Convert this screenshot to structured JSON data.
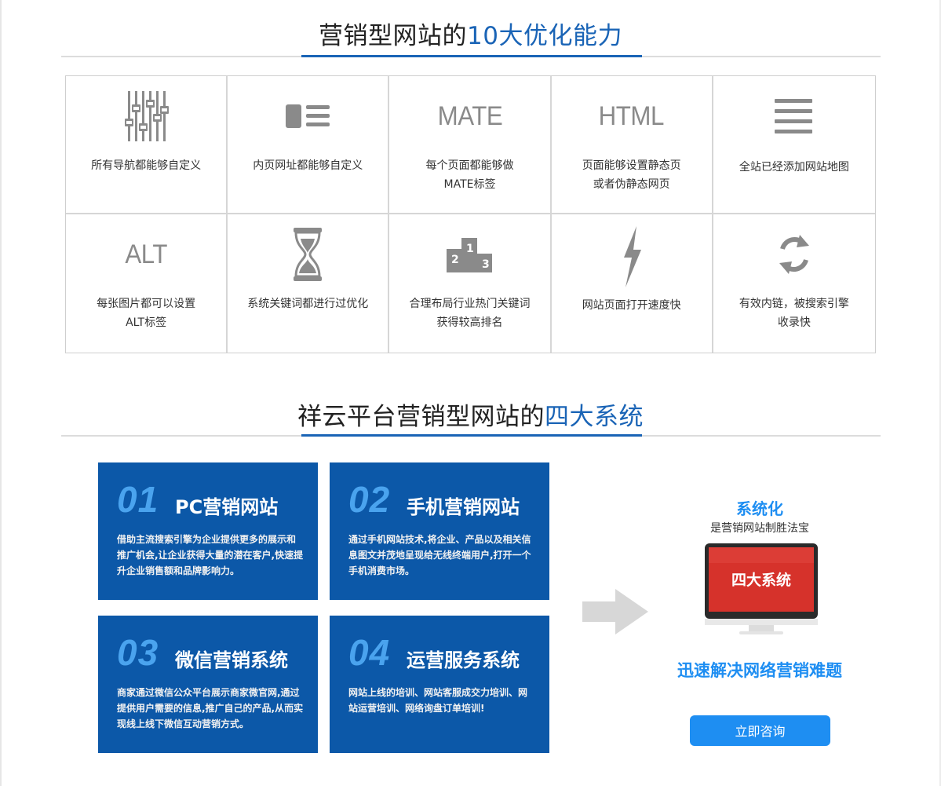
{
  "section1": {
    "title_main": "营销型网站的",
    "title_highlight": "10大优化能力"
  },
  "features": [
    {
      "icon": "sliders-icon",
      "caption": "所有导航都能够自定义"
    },
    {
      "icon": "list-layout-icon",
      "caption": "内页网址都能够自定义"
    },
    {
      "icon": "mate-text-icon",
      "icon_text": "MATE",
      "caption": "每个页面都能够做\nMATE标签"
    },
    {
      "icon": "html-text-icon",
      "icon_text": "HTML",
      "caption": "页面能够设置静态页\n或者伪静态网页"
    },
    {
      "icon": "menu-lines-icon",
      "caption": "全站已经添加网站地图"
    },
    {
      "icon": "alt-text-icon",
      "icon_text": "ALT",
      "caption": "每张图片都可以设置\nALT标签"
    },
    {
      "icon": "hourglass-icon",
      "caption": "系统关键词都进行过优化"
    },
    {
      "icon": "podium-icon",
      "caption": "合理布局行业热门关键词\n获得较高排名"
    },
    {
      "icon": "lightning-icon",
      "caption": "网站页面打开速度快"
    },
    {
      "icon": "refresh-icon",
      "caption": "有效内链，被搜索引擎\n收录快"
    }
  ],
  "section2": {
    "title_main": "祥云平台营销型网站的",
    "title_highlight": "四大系统"
  },
  "systems": [
    {
      "num": "01",
      "name": "PC营销网站",
      "desc": "借助主流搜索引擎为企业提供更多的展示和推广机会,让企业获得大量的潜在客户,快速提升企业销售额和品牌影响力。"
    },
    {
      "num": "02",
      "name": "手机营销网站",
      "desc": "通过手机网站技术,将企业、产品以及相关信息图文并茂地呈现给无线终端用户,打开一个手机消费市场。"
    },
    {
      "num": "03",
      "name": "微信营销系统",
      "desc": "商家通过微信公众平台展示商家微官网,通过提供用户需要的信息,推广自己的产品,从而实现线上线下微信互动营销方式。"
    },
    {
      "num": "04",
      "name": "运营服务系统",
      "desc": "网站上线的培训、网站客服成交力培训、网站运营培训、网络询盘订单培训!"
    }
  ],
  "side_panel": {
    "heading": "系统化",
    "subheading": "是营销网站制胜法宝",
    "monitor_text": "四大系统",
    "tagline": "迅速解决网络营销难题",
    "button_label": "立即咨询"
  },
  "colors": {
    "brand_blue": "#1a64b6",
    "card_blue": "#0c58a8",
    "number_blue": "#4aa3ee",
    "button_blue": "#1e8ef2",
    "monitor_red": "#d6322b"
  }
}
